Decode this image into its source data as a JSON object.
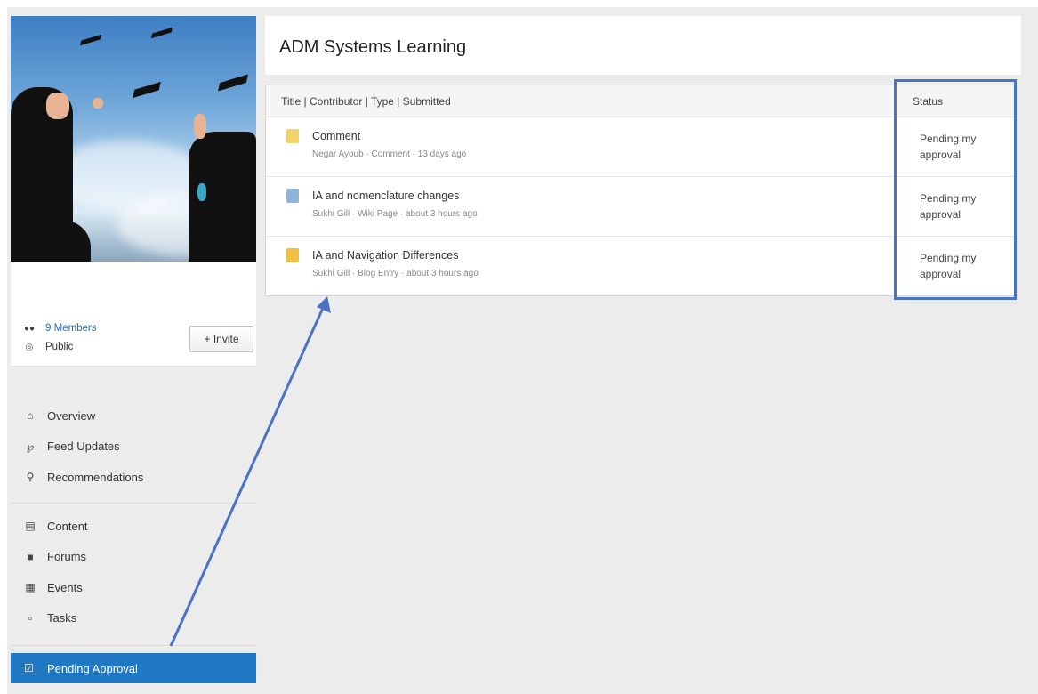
{
  "group": {
    "title": "ADM Systems Learning",
    "members_label": "9 Members",
    "visibility_label": "Public",
    "invite_label": "+ Invite"
  },
  "sidebar": {
    "section1": [
      {
        "label": "Overview",
        "icon": "home-icon"
      },
      {
        "label": "Feed Updates",
        "icon": "rss-icon"
      },
      {
        "label": "Recommendations",
        "icon": "lightbulb-icon"
      }
    ],
    "section2": [
      {
        "label": "Content",
        "icon": "document-icon"
      },
      {
        "label": "Forums",
        "icon": "chat-icon"
      },
      {
        "label": "Events",
        "icon": "calendar-icon"
      },
      {
        "label": "Tasks",
        "icon": "clipboard-icon"
      }
    ],
    "active_item": {
      "label": "Pending Approval",
      "icon": "pending-icon"
    }
  },
  "table": {
    "columns_label": "Title | Contributor | Type | Submitted",
    "status_header": "Status",
    "rows": [
      {
        "title": "Comment",
        "meta": "Negar Ayoub · Comment · 13 days ago",
        "status": "Pending my approval",
        "icon": "comment-icon",
        "icon_color": "#f2d26b"
      },
      {
        "title": "IA and nomenclature changes",
        "meta": "Sukhi Gill · Wiki Page · about 3 hours ago",
        "status": "Pending my approval",
        "icon": "wiki-page-icon",
        "icon_color": "#8fb4dc"
      },
      {
        "title": "IA and Navigation Differences",
        "meta": "Sukhi Gill · Blog Entry · about 3 hours ago",
        "status": "Pending my approval",
        "icon": "blog-entry-icon",
        "icon_color": "#f0c040"
      }
    ]
  },
  "colors": {
    "accent": "#1f78c1",
    "highlight_box": "#4a72c5",
    "arrow": "#4a72c5",
    "link": "#2a6db3",
    "background": "#ececec"
  }
}
